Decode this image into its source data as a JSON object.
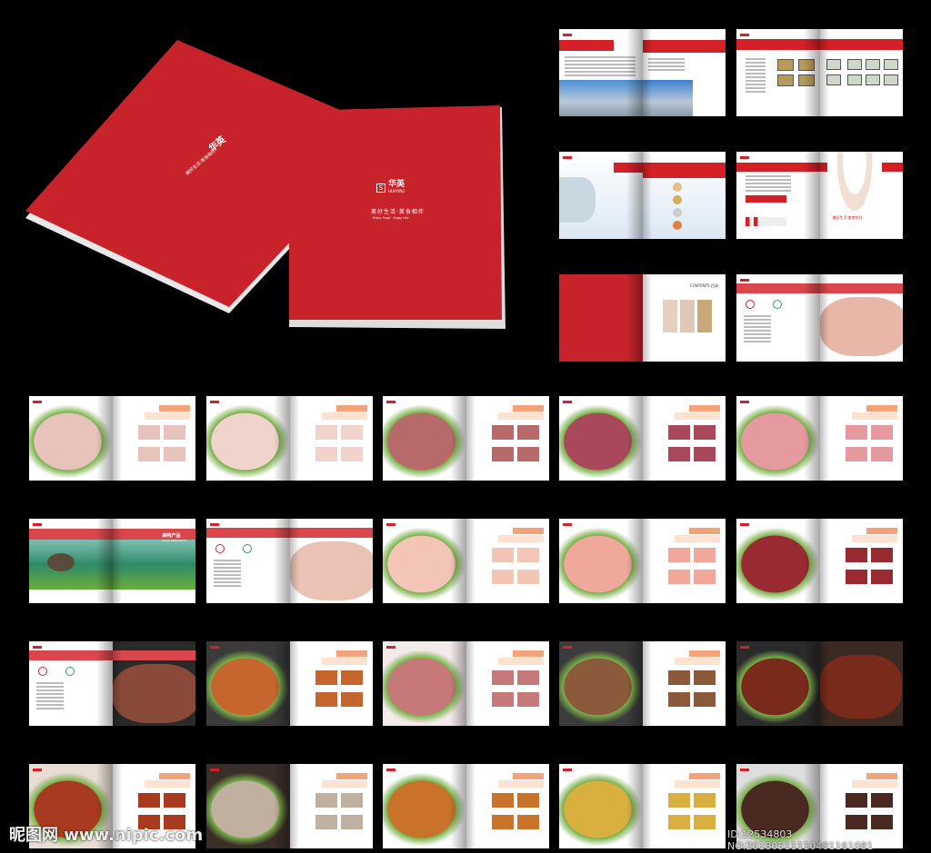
{
  "cover": {
    "brand_cn": "华英",
    "brand_en": "HUAYING",
    "slogan": "美好生活·美食相伴",
    "slogan_en": "Enjoy Food · Enjoy Life",
    "color": "#c8232b"
  },
  "labels": {
    "contents": "CONTENTS 目录",
    "duck_title": "麻鸭产品",
    "duck_sub": "DUCK PRODUCTS",
    "chef_slogan": "美好生活·美食相伴"
  },
  "watermark": {
    "site": "昵图网 www.nipic.com",
    "id": "ID:12534803 NO:20180511110401161081"
  },
  "spreads": [
    {
      "type": "intro"
    },
    {
      "type": "cert"
    },
    {
      "type": "science"
    },
    {
      "type": "chef"
    },
    {
      "type": "contents"
    },
    {
      "type": "product-intro",
      "photo": "#e8b7a8"
    },
    {
      "type": "food",
      "photo": "#e7c3bb",
      "bg": "#fff"
    },
    {
      "type": "food",
      "photo": "#f0d4cc",
      "bg": "#fff"
    },
    {
      "type": "food",
      "photo": "#b86a6a",
      "bg": "#fff"
    },
    {
      "type": "food",
      "photo": "#a8485a",
      "bg": "#fff"
    },
    {
      "type": "food",
      "photo": "#e49a9e",
      "bg": "#fff"
    },
    {
      "type": "duck"
    },
    {
      "type": "product-intro",
      "photo": "#eac3b4"
    },
    {
      "type": "food",
      "photo": "#f2c5b6",
      "bg": "#fff"
    },
    {
      "type": "food",
      "photo": "#f0a89a",
      "bg": "#fff"
    },
    {
      "type": "food",
      "photo": "#9a2a32",
      "bg": "#fff"
    },
    {
      "type": "product-intro",
      "photo": "#8a4a3a",
      "dark": true
    },
    {
      "type": "food",
      "photo": "#c7652e",
      "bg": "#3a3a3a"
    },
    {
      "type": "food",
      "photo": "#c77878",
      "bg": "#f3eaea"
    },
    {
      "type": "food",
      "photo": "#8a5a3a",
      "bg": "#3b3b3b"
    },
    {
      "type": "food",
      "photo": "#7a2a1a",
      "bg": "#2a2a2a",
      "rightphoto": true
    },
    {
      "type": "food",
      "photo": "#a83a20",
      "bg": "#e8ddd5"
    },
    {
      "type": "food",
      "photo": "#c0b0a0",
      "bg": "#3a2e28"
    },
    {
      "type": "food",
      "photo": "#c8722a",
      "bg": "#fff"
    },
    {
      "type": "food",
      "photo": "#d9b040",
      "bg": "#fff"
    },
    {
      "type": "food",
      "photo": "#4a2a20",
      "bg": "#ddd"
    }
  ]
}
